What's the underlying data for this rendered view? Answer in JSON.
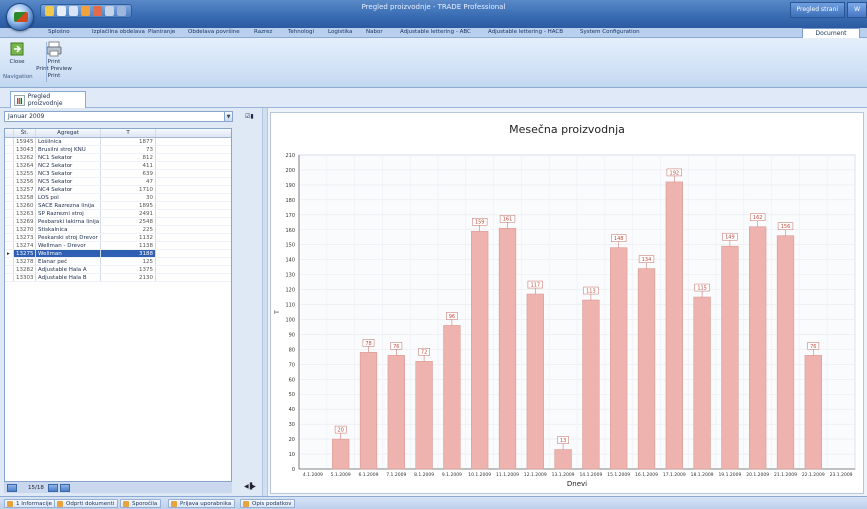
{
  "window": {
    "title": "Pregled proizvodnje - TRADE Professional",
    "right_buttons": [
      "Pregled strani",
      "W"
    ]
  },
  "ribbon": {
    "tabs": [
      "Splošno",
      "Izplačilna obdelava",
      "Planiranje",
      "Obdelava površine",
      "Razrez",
      "Tehnologi",
      "Logistika",
      "Nabor",
      "Adjustable lettering - ABC",
      "Adjustable lettering - HACB",
      "System Configuration"
    ],
    "active_tab": "Document",
    "buttons": {
      "close": "Close",
      "print": "Print",
      "print_preview": "Print Preview",
      "print_line": "Print"
    },
    "group_label": "Navigation"
  },
  "doc_tab": {
    "label": "Pregled proizvodnje"
  },
  "left": {
    "period": "Januar 2009",
    "grid_headers": [
      "Št.",
      "Agregat",
      "T"
    ],
    "rows": [
      {
        "id": "15945",
        "name": "Lošilnica",
        "t": "1877"
      },
      {
        "id": "13043",
        "name": "Brusilni stroj KNU",
        "t": "73"
      },
      {
        "id": "13262",
        "name": "NC1 Sekator",
        "t": "812"
      },
      {
        "id": "13264",
        "name": "NC2 Sekator",
        "t": "411"
      },
      {
        "id": "13255",
        "name": "NC3 Sekator",
        "t": "639"
      },
      {
        "id": "13256",
        "name": "NC5 Sekator",
        "t": "47"
      },
      {
        "id": "13257",
        "name": "NC4 Sekator",
        "t": "1710"
      },
      {
        "id": "13258",
        "name": "LOS pol",
        "t": "30"
      },
      {
        "id": "13260",
        "name": "SACE Razrezna linija",
        "t": "1895"
      },
      {
        "id": "13263",
        "name": "SP Razrezni stroj",
        "t": "2491"
      },
      {
        "id": "13269",
        "name": "Pesbarski lakirna linija",
        "t": "2548"
      },
      {
        "id": "13270",
        "name": "Stiskalnica",
        "t": "225"
      },
      {
        "id": "13273",
        "name": "Peskarski stroj Drevor",
        "t": "1132"
      },
      {
        "id": "13274",
        "name": "Wellman - Drevor",
        "t": "1138"
      },
      {
        "id": "13275",
        "name": "Wellman",
        "t": "3188"
      },
      {
        "id": "13278",
        "name": "Elanar peč",
        "t": "125"
      },
      {
        "id": "13282",
        "name": "Adjustable Hala A",
        "t": "1375"
      },
      {
        "id": "13303",
        "name": "Adjustable Hala B",
        "t": "2130"
      }
    ],
    "selected_index": 14,
    "nav_count": "15/18"
  },
  "chart_data": {
    "type": "bar",
    "title": "Mesečna proizvodnja",
    "xlabel": "Dnevi",
    "ylabel": "T",
    "ylim": [
      0,
      210
    ],
    "ytick_step": 10,
    "bar_color": "#eeb3ae",
    "bar_border": "#d99a94",
    "categories": [
      "4.1.2009",
      "5.1.2009",
      "6.1.2009",
      "7.1.2009",
      "8.1.2009",
      "9.1.2009",
      "10.1.2009",
      "11.1.2009",
      "12.1.2009",
      "13.1.2009",
      "14.1.2009",
      "15.1.2009",
      "16.1.2009",
      "17.1.2009",
      "18.1.2009",
      "19.1.2009",
      "20.1.2009",
      "21.1.2009",
      "22.1.2009",
      "23.1.2009"
    ],
    "values": [
      null,
      20,
      78,
      76,
      72,
      96,
      159,
      161,
      117,
      13,
      113,
      148,
      134,
      192,
      115,
      149,
      162,
      156,
      76,
      null
    ],
    "labels": [
      "",
      "20",
      "78",
      "76",
      "72",
      "96",
      "159",
      "161",
      "117",
      "13",
      "113",
      "148",
      "134",
      "192",
      "115",
      "149",
      "162",
      "156",
      "76",
      ""
    ]
  },
  "statusbar": {
    "items": [
      "1 Informacije",
      "Odprti dokumenti",
      "Sporočila",
      "Prijava uporabnika",
      "Opis podatkov"
    ]
  }
}
